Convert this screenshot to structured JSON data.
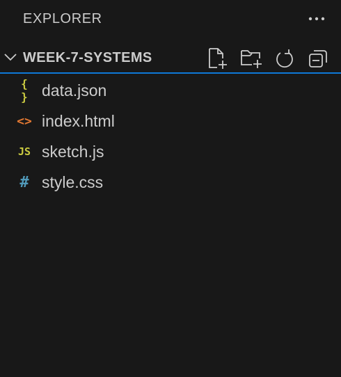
{
  "header": {
    "title": "EXPLORER",
    "more_icon": "ellipsis-icon"
  },
  "section": {
    "title": "WEEK-7-SYSTEMS",
    "expanded": true,
    "actions": [
      {
        "name": "new-file",
        "icon": "new-file-icon"
      },
      {
        "name": "new-folder",
        "icon": "new-folder-icon"
      },
      {
        "name": "refresh",
        "icon": "refresh-icon"
      },
      {
        "name": "collapse-all",
        "icon": "collapse-all-icon"
      }
    ]
  },
  "files": [
    {
      "name": "data.json",
      "glyph": "{ }",
      "icon": "json-icon",
      "color": "#cbcb41"
    },
    {
      "name": "index.html",
      "glyph": "<>",
      "icon": "html-icon",
      "color": "#e37933"
    },
    {
      "name": "sketch.js",
      "glyph": "JS",
      "icon": "javascript-icon",
      "color": "#cbcb41"
    },
    {
      "name": "style.css",
      "glyph": "#",
      "icon": "css-icon",
      "color": "#519aba"
    }
  ],
  "colors": {
    "background": "#181818",
    "text": "#cccccc",
    "focus_border": "#0e79d8"
  }
}
